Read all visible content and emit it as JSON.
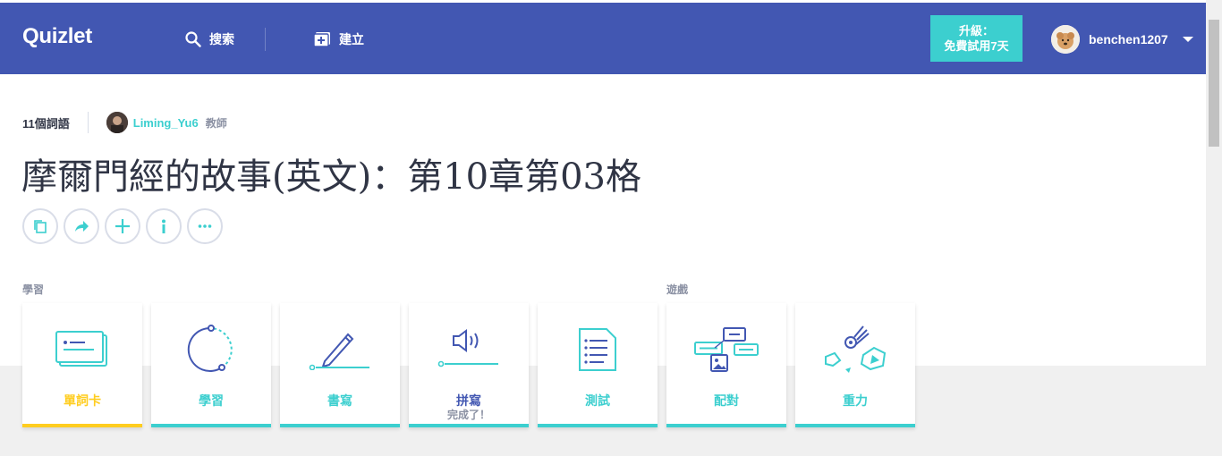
{
  "header": {
    "logo": "Quizlet",
    "search_label": "搜索",
    "create_label": "建立",
    "upgrade_line1": "升級：",
    "upgrade_line2": "免費試用7天",
    "username": "benchen1207"
  },
  "set": {
    "term_count": "11個詞語",
    "creator_name": "Liming_Yu6",
    "creator_role": "教師",
    "title": "摩爾門經的故事(英文)：第10章第03格"
  },
  "sections": {
    "study": "學習",
    "games": "遊戲"
  },
  "cards": [
    {
      "label": "單詞卡",
      "sub": ""
    },
    {
      "label": "學習",
      "sub": ""
    },
    {
      "label": "書寫",
      "sub": ""
    },
    {
      "label": "拼寫",
      "sub": "完成了！"
    },
    {
      "label": "測試",
      "sub": ""
    },
    {
      "label": "配對",
      "sub": ""
    },
    {
      "label": "重力",
      "sub": ""
    }
  ],
  "colors": {
    "header_bg": "#4257b2",
    "accent_teal": "#3ccfcf",
    "accent_yellow": "#ffcd1f",
    "text_dark": "#303545"
  },
  "icons": {
    "search": "search-icon",
    "create": "create-plus-icon",
    "caret": "chevron-down-icon",
    "copy": "copy-icon",
    "share": "share-icon",
    "add": "plus-icon",
    "info": "info-icon",
    "more": "more-icon"
  }
}
